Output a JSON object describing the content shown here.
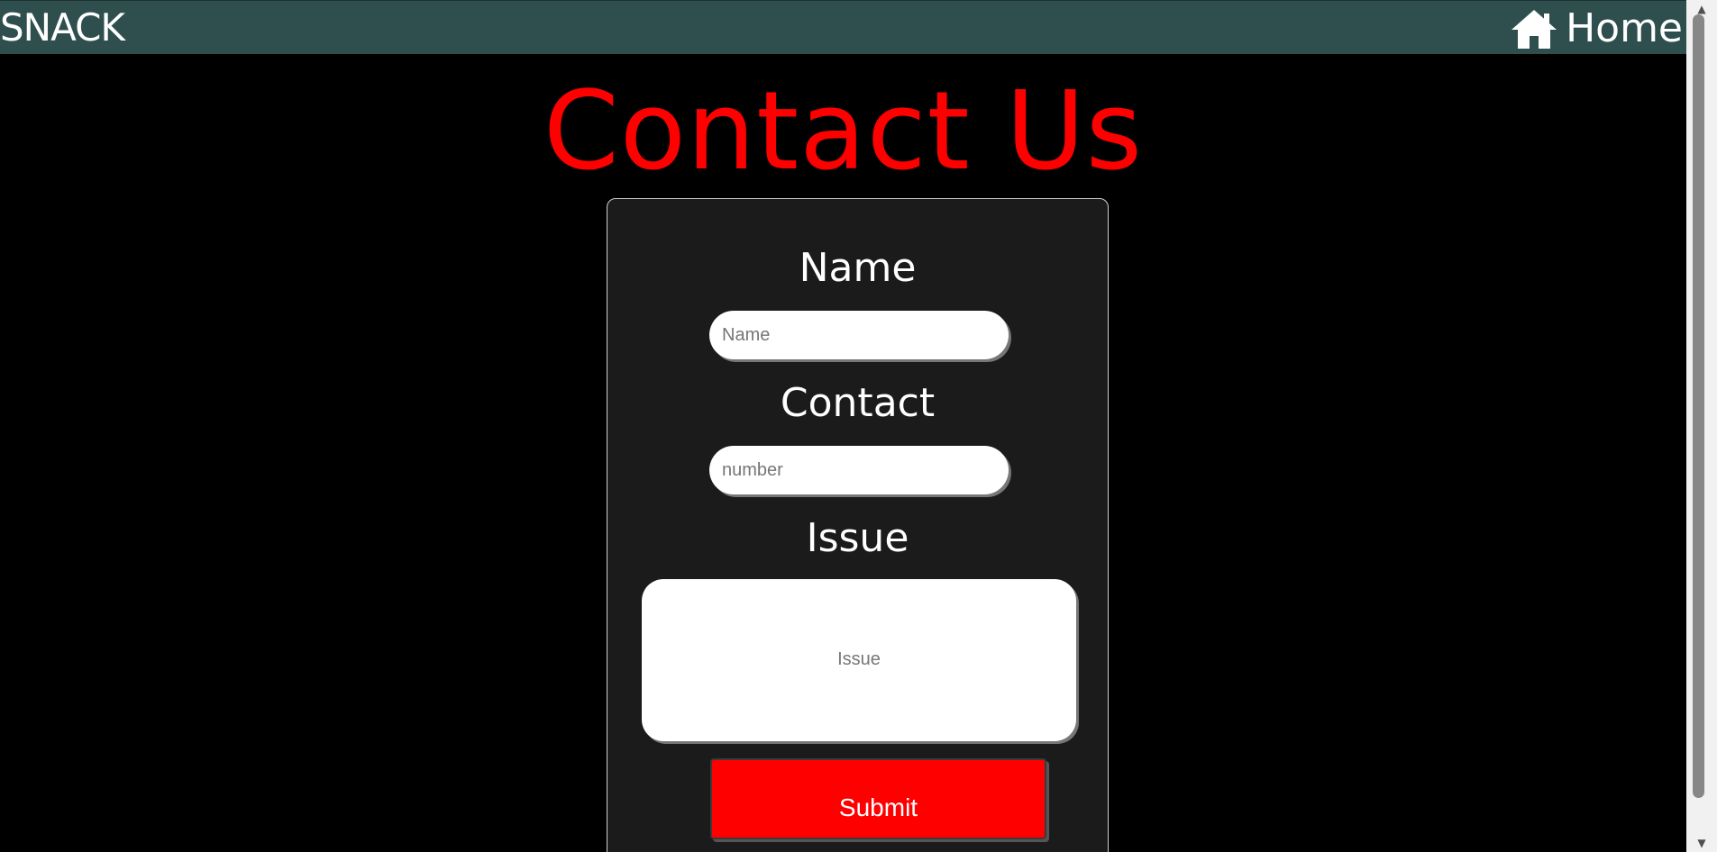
{
  "navbar": {
    "brand": "SNACK",
    "home_label": "Home",
    "home_icon": "home-icon",
    "background": "#2f4f4f"
  },
  "page": {
    "title": "Contact Us",
    "title_color": "#ff0000"
  },
  "form": {
    "name_label": "Name",
    "name_placeholder": "Name",
    "name_value": "",
    "contact_label": "Contact",
    "contact_placeholder": "number",
    "contact_value": "",
    "issue_label": "Issue",
    "issue_placeholder": "Issue",
    "issue_value": "",
    "submit_label": "Submit",
    "submit_color": "#ff0000"
  }
}
